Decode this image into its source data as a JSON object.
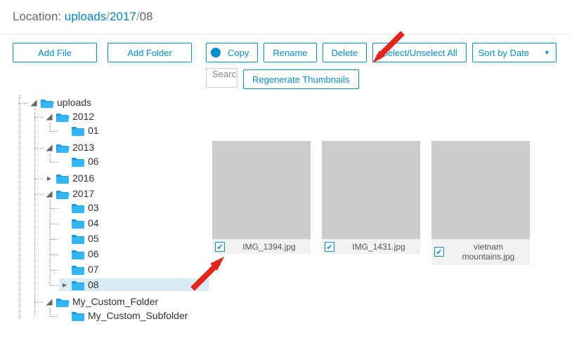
{
  "location": {
    "label": "Location:",
    "parts": [
      "uploads",
      "2017",
      "08"
    ]
  },
  "buttons": {
    "addFile": "Add File",
    "addFolder": "Add Folder",
    "copy": "Copy",
    "rename": "Rename",
    "delete": "Delete",
    "selectAll": "Select/Unselect All",
    "regen": "Regenerate Thumbnails",
    "sort": "Sort by Date"
  },
  "searchPlaceholder": "Search",
  "tree": {
    "root": "uploads",
    "y2012": "2012",
    "m01": "01",
    "y2013": "2013",
    "m06": "06",
    "y2016": "2016",
    "y2017": "2017",
    "m03": "03",
    "m04": "04",
    "m05": "05",
    "m06b": "06",
    "m07": "07",
    "m08": "08",
    "custom": "My_Custom_Folder",
    "customSub": "My_Custom_Subfolder"
  },
  "files": {
    "f1": "IMG_1394.jpg",
    "f2": "IMG_1431.jpg",
    "f3": "vietnam mountains.jpg"
  }
}
